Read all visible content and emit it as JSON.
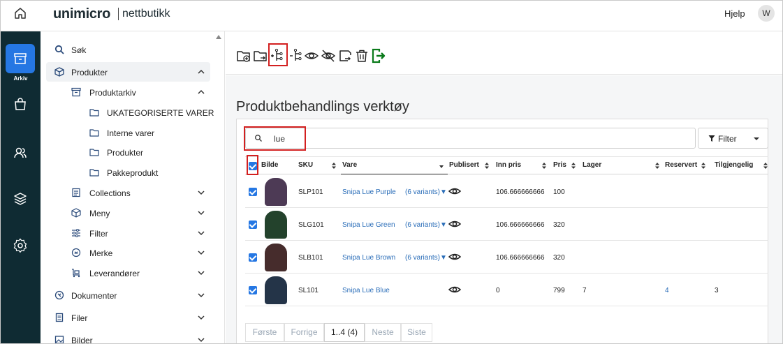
{
  "header": {
    "logo": "unimicro",
    "logo_sub": "nettbutikk",
    "help": "Hjelp",
    "avatar": "W"
  },
  "rail": {
    "active_label": "Arkiv",
    "icons": [
      "archive-icon",
      "bag-icon",
      "users-icon",
      "layers-icon",
      "settings-icon"
    ]
  },
  "sidebar": {
    "items": [
      {
        "label": "Søk",
        "icon": "search-icon"
      },
      {
        "label": "Produkter",
        "icon": "box-icon",
        "expanded": true
      },
      {
        "label": "Produktarkiv",
        "icon": "archive-icon",
        "expanded": true
      },
      {
        "label": "UKATEGORISERTE VARER",
        "icon": "folder-icon"
      },
      {
        "label": "Interne varer",
        "icon": "folder-icon"
      },
      {
        "label": "Produkter",
        "icon": "folder-icon"
      },
      {
        "label": "Pakkeprodukt",
        "icon": "folder-icon"
      },
      {
        "label": "Collections",
        "icon": "collection-icon"
      },
      {
        "label": "Meny",
        "icon": "box-icon"
      },
      {
        "label": "Filter",
        "icon": "sliders-icon"
      },
      {
        "label": "Merke",
        "icon": "badge-icon"
      },
      {
        "label": "Leverandører",
        "icon": "truck-icon"
      },
      {
        "label": "Dokumenter",
        "icon": "document-icon"
      },
      {
        "label": "Filer",
        "icon": "file-icon"
      },
      {
        "label": "Bilder",
        "icon": "image-icon"
      }
    ]
  },
  "toolbar": {
    "icons": [
      "add-folder-icon",
      "move-folder-icon",
      "add-variant-icon",
      "remove-variant-icon",
      "publish-icon",
      "unpublish-icon",
      "export-icon",
      "delete-icon",
      "exit-icon"
    ]
  },
  "page": {
    "title": "Produktbehandlings verktøy"
  },
  "search": {
    "value": "lue",
    "placeholder": ""
  },
  "filter": {
    "label": "Filter"
  },
  "table": {
    "columns": [
      "Bilde",
      "SKU",
      "Vare",
      "Publisert",
      "Inn pris",
      "Pris",
      "Lager",
      "Reservert",
      "Tilgjengelig"
    ],
    "rows": [
      {
        "sku": "SLP101",
        "vare": "Snipa Lue Purple",
        "variants": "(6 variants)▼",
        "inn_pris": "106.666666666",
        "pris": "100",
        "lager": "",
        "reservert": "",
        "tilgjengelig": "",
        "color": "#4d3a55"
      },
      {
        "sku": "SLG101",
        "vare": "Snipa Lue Green",
        "variants": "(6 variants)▼",
        "inn_pris": "106.666666666",
        "pris": "320",
        "lager": "",
        "reservert": "",
        "tilgjengelig": "",
        "color": "#23422c"
      },
      {
        "sku": "SLB101",
        "vare": "Snipa Lue Brown",
        "variants": "(6 variants)▼",
        "inn_pris": "106.666666666",
        "pris": "320",
        "lager": "",
        "reservert": "",
        "tilgjengelig": "",
        "color": "#462c2c"
      },
      {
        "sku": "SL101",
        "vare": "Snipa Lue Blue",
        "variants": "",
        "inn_pris": "0",
        "pris": "799",
        "lager": "7",
        "reservert": "4",
        "tilgjengelig": "3",
        "color": "#243448"
      }
    ]
  },
  "pager": {
    "first": "Første",
    "prev": "Forrige",
    "current": "1..4 (4)",
    "next": "Neste",
    "last": "Siste"
  },
  "colors": {
    "accent": "#2577e3",
    "rail": "#0f2b33",
    "highlight": "#d32020",
    "link": "#2a6db8"
  }
}
